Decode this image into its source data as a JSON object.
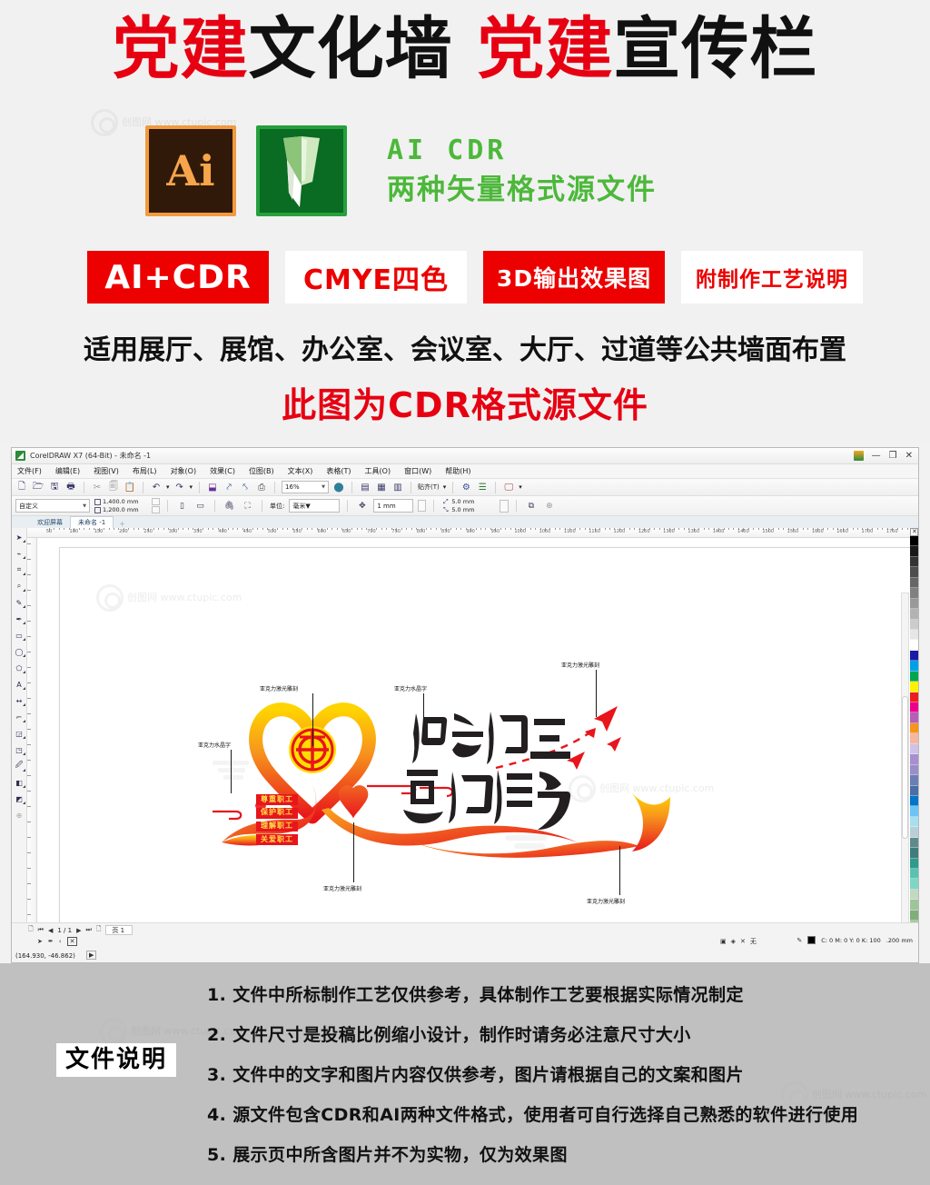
{
  "promo": {
    "headline_parts": [
      {
        "text": "党建",
        "color": "red"
      },
      {
        "text": "文化墙 ",
        "color": "black"
      },
      {
        "text": "党建",
        "color": "red"
      },
      {
        "text": "宣传栏",
        "color": "black"
      }
    ],
    "headline_full": "党建文化墙 党建宣传栏",
    "ai_badge_label": "Ai",
    "format_line_1": "AI  CDR",
    "format_line_2": "两种矢量格式源文件",
    "badges": [
      {
        "label": "AI+CDR",
        "style": "solid"
      },
      {
        "label": "CMYE四色",
        "style": "outline"
      },
      {
        "label": "3D输出效果图",
        "style": "solid"
      },
      {
        "label": "附制作工艺说明",
        "style": "outline"
      }
    ],
    "sub_line": "适用展厅、展馆、办公室、会议室、大厅、过道等公共墙面布置",
    "red_line": "此图为CDR格式源文件",
    "colors": {
      "red": "#e60012",
      "badge_red": "#ec0000",
      "green": "#4cb83a",
      "ai_orange": "#f7a54a"
    }
  },
  "app": {
    "title": "CorelDRAW X7 (64-Bit) - 未命名 -1",
    "window_controls": {
      "minimize": "—",
      "restore": "❐",
      "close": "✕"
    },
    "menu": [
      {
        "label": "文件(F)"
      },
      {
        "label": "编辑(E)"
      },
      {
        "label": "视图(V)"
      },
      {
        "label": "布局(L)"
      },
      {
        "label": "对象(O)"
      },
      {
        "label": "效果(C)"
      },
      {
        "label": "位图(B)"
      },
      {
        "label": "文本(X)"
      },
      {
        "label": "表格(T)"
      },
      {
        "label": "工具(O)"
      },
      {
        "label": "窗口(W)"
      },
      {
        "label": "帮助(H)"
      }
    ],
    "toolbar": {
      "zoom_level": "16%",
      "snap_label": "贴齐(T)",
      "icons": [
        "new-document-icon",
        "open-document-icon",
        "save-icon",
        "print-icon",
        "cut-icon",
        "copy-icon",
        "paste-icon",
        "undo-icon",
        "redo-icon",
        "import-icon",
        "export-icon",
        "publish-pdf-icon"
      ]
    },
    "property_bar": {
      "preset": "自定义",
      "width": "1,400.0 mm",
      "height": "1,200.0 mm",
      "orientation_portrait": "portrait-icon",
      "orientation_landscape": "landscape-icon",
      "units_label": "单位:",
      "units": "毫米",
      "nudge": "1 mm",
      "duplicate_x": "5.0 mm",
      "duplicate_y": "5.0 mm"
    },
    "tabs": [
      {
        "label": "欢迎屏幕",
        "active": false
      },
      {
        "label": "未命名 -1",
        "active": true
      },
      {
        "label": "+",
        "active": false
      }
    ],
    "ruler": {
      "h_ticks": [
        "50",
        "100",
        "150",
        "200",
        "250",
        "300",
        "350",
        "400",
        "450",
        "500",
        "550",
        "600",
        "650",
        "700",
        "750",
        "800",
        "850",
        "900",
        "950",
        "1000",
        "1050",
        "1100",
        "1150",
        "1200",
        "1250",
        "1300",
        "1350",
        "1400",
        "1450",
        "1500",
        "1550",
        "1600",
        "1650",
        "1700",
        "1750"
      ],
      "unit": "mm"
    },
    "toolbox": [
      "pick-tool-icon",
      "shape-tool-icon",
      "crop-tool-icon",
      "zoom-tool-icon",
      "freehand-tool-icon",
      "artistic-media-icon",
      "rectangle-tool-icon",
      "ellipse-tool-icon",
      "polygon-tool-icon",
      "text-tool-icon",
      "parallel-dimension-icon",
      "connector-tool-icon",
      "drop-shadow-icon",
      "transparency-tool-icon",
      "color-eyedropper-icon",
      "interactive-fill-icon",
      "smart-fill-icon",
      "add-tool-icon"
    ],
    "status_bar": {
      "page_indicator": "1 / 1",
      "page_tab": "页 1",
      "coordinates": "(164.930, -46.862)",
      "fill_none": "无",
      "outline_color": "C: 0 M: 0 Y: 0 K: 100",
      "outline_width": ".200 mm"
    }
  },
  "artwork": {
    "calligraphy_line_1": "情系职工",
    "calligraphy_line_2": "真诚服务",
    "keywords": [
      "尊重职工",
      "保护职工",
      "理解职工",
      "关爱职工"
    ],
    "annotations": [
      {
        "text": "亚克力水晶字",
        "position": "left"
      },
      {
        "text": "亚克力激光雕刻",
        "position": "top-center"
      },
      {
        "text": "亚克力水晶字",
        "position": "top-right-center"
      },
      {
        "text": "亚克力激光雕刻",
        "position": "top-right"
      },
      {
        "text": "亚克力激光雕刻",
        "position": "bottom-center"
      },
      {
        "text": "亚克力激光雕刻",
        "position": "bottom-right"
      }
    ],
    "colors": {
      "ribbon_red": "#e8151b",
      "ribbon_orange": "#f7941d",
      "ribbon_yellow": "#ffd400",
      "keyword_bg": "#e8151b",
      "keyword_text": "#ffe24a",
      "emblem_yellow": "#ffdd00",
      "emblem_red": "#e8151b",
      "ink_black": "#231f20"
    }
  },
  "notes": {
    "label": "文件说明",
    "items": [
      "1. 文件中所标制作工艺仅供参考，具体制作工艺要根据实际情况制定",
      "2. 文件尺寸是投稿比例缩小设计，制作时请务必注意尺寸大小",
      "3. 文件中的文字和图片内容仅供参考，图片请根据自己的文案和图片",
      "4. 源文件包含CDR和AI两种文件格式，使用者可自行选择自己熟悉的软件进行使用",
      "5. 展示页中所含图片并不为实物，仅为效果图"
    ]
  },
  "watermark": {
    "text": "创图网 www.ctupic.com"
  }
}
